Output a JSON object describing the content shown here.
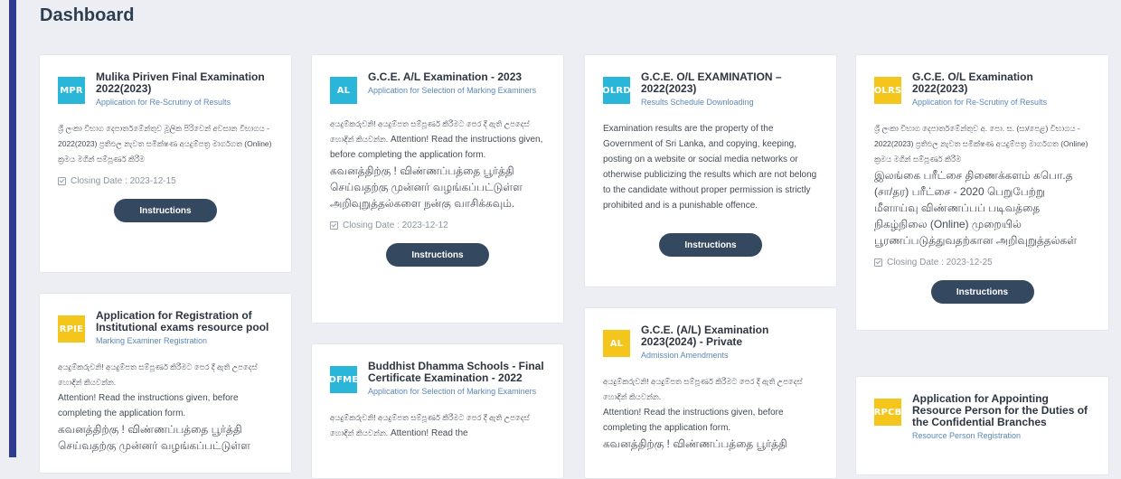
{
  "page": {
    "title": "Dashboard"
  },
  "cards": [
    {
      "badge": "MPR",
      "badge_color": "#29b6d9",
      "title": "Mulika Piriven Final Examination 2022(2023)",
      "subtitle": "Application for Re-Scrutiny of Results",
      "desc_si": "ශ්‍රී ලංකා විභාග දෙපාර්තමේන්තුව මූලික පිරිවෙන් අවසාන විභාගය - 2022(2023) ප්‍රතිඵල නැවත සමීක්ෂණ අයදුම්පත්‍ර මාර්ගගත (Online) ක්‍රමය මගින් සම්පූර්ණ කිරීම",
      "closing": "Closing Date : 2023-12-15",
      "button": "Instructions"
    },
    {
      "badge": "RPIE",
      "badge_color": "#f4c51a",
      "title": "Application for Registration of Institutional exams resource pool",
      "subtitle": "Marking Examiner Registration",
      "desc_si": "අයදුම්කරුවනි! අයදුම්පත සම්පූර්ණ කිරීමට පෙර දී ඇති උපදෙස් හොඳින් කියවන්න.",
      "desc_en": "Attention! Read the instructions given, before completing the application form.",
      "desc_ta": "கவனத்திற்கு ! விண்ணப்பத்தை பூர்த்தி செய்வதற்கு முன்னர் வழங்கப்பட்டுள்ள"
    },
    {
      "badge": "AL",
      "badge_color": "#29b6d9",
      "title": "G.C.E. A/L Examination - 2023",
      "subtitle": "Application for Selection of Marking Examiners",
      "desc_si": "අයදුම්කරුවනි! අයදුම්පත සම්පූර්ණ කිරීමට පෙර දී ඇති උපදෙස් හොඳින් කියවන්න.",
      "desc_en": "Attention! Read the instructions given, before completing the application form.",
      "desc_ta": "கவனத்திற்கு ! விண்ணப்பத்தை பூர்த்தி செய்வதற்கு முன்னர் வழங்கப்பட்டுள்ள அறிவுறுத்தல்களை நன்கு வாசிக்கவும்.",
      "closing": "Closing Date : 2023-12-12",
      "button": "Instructions"
    },
    {
      "badge": "DFME",
      "badge_color": "#29b6d9",
      "title": "Buddhist Dhamma Schools - Final Certificate Examination - 2022",
      "subtitle": "Application for Selection of Marking Examiners",
      "desc_si": "අයදුම්කරුවනි! අයදුම්පත සම්පූර්ණ කිරීමට පෙර දී ඇති උපදෙස් හොඳින් කියවන්න.",
      "desc_en": "Attention! Read the"
    },
    {
      "badge": "OLRD",
      "badge_color": "#29b6d9",
      "title": "G.C.E. O/L EXAMINATION – 2022(2023)",
      "subtitle": "Results Schedule Downloading",
      "desc_en": "Examination results are the property of the Government of Sri Lanka, and copying, keeping, posting on a website or social media networks or otherwise publicizing the results which are not belong to the candidate without proper permission is strictly prohibited and is a punishable offence.",
      "button": "Instructions"
    },
    {
      "badge": "AL",
      "badge_color": "#f4c51a",
      "title": "G.C.E. (A/L) Examination 2023(2024) - Private",
      "subtitle": "Admission Amendments",
      "desc_si": "අයදුම්කරුවනි! අයදුම්පත සම්පූර්ණ කිරීමට පෙර දී ඇති උපදෙස් හොඳින් කියවන්න.",
      "desc_en": "Attention! Read the instructions given, before completing the application form.",
      "desc_ta": "கவனத்திற்கு ! விண்ணப்பத்தை பூர்த்தி"
    },
    {
      "badge": "OLRS",
      "badge_color": "#f4c51a",
      "title": "G.C.E. O/L Examination 2022(2023)",
      "subtitle": "Application for Re-Scrutiny of Results",
      "desc_si": "ශ්‍රී ලංකා විභාග දෙපාර්තමේන්තුව අ. පො. ස. (සා/පෙළ) විභාගය - 2022(2023) ප්‍රතිඵල නැවත සමීක්ෂණ අයදුම්පත්‍ර මාර්ගගත (Online) ක්‍රමය මගින් සම්පූර්ණ කිරීම",
      "desc_ta": "இலங்கை பரீட்சை திணைக்களம் கபொ.த (சா/தர) பரீட்சை - 2020 பெறுபேற்று மீளாய்வு விண்ணப்பப் படிவத்தை நிகழ்நிலை (Online) முறையில் பூரணப்படுத்துவதற்கான அறிவுறுத்தல்கள்",
      "closing": "Closing Date : 2023-12-25",
      "button": "Instructions"
    },
    {
      "badge": "RPCB",
      "badge_color": "#f4c51a",
      "title": "Application for Appointing Resource Person for the Duties of the Confidential Branches",
      "subtitle": "Resource Person Registration"
    }
  ]
}
